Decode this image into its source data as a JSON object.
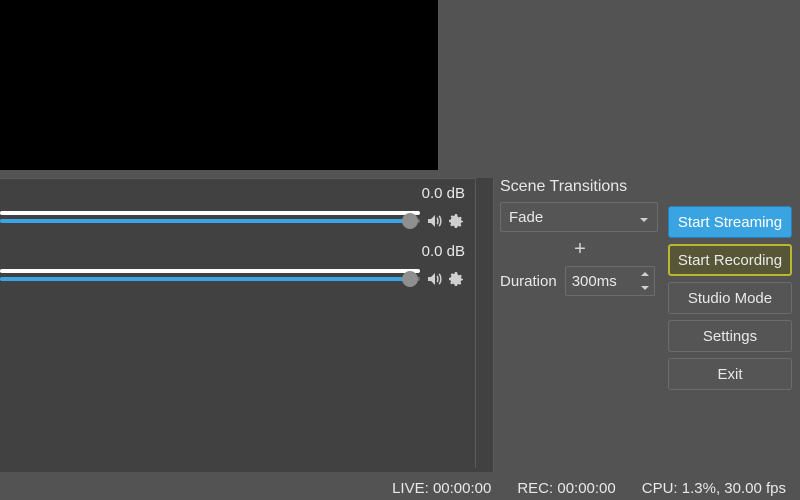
{
  "mixer": {
    "channels": [
      {
        "db": "0.0 dB"
      },
      {
        "db": "0.0 dB"
      }
    ]
  },
  "transitions": {
    "title": "Scene Transitions",
    "selected": "Fade",
    "duration_label": "Duration",
    "duration_value": "300ms"
  },
  "controls": {
    "start_streaming": "Start Streaming",
    "start_recording": "Start Recording",
    "studio_mode": "Studio Mode",
    "settings": "Settings",
    "exit": "Exit"
  },
  "status": {
    "live": "LIVE: 00:00:00",
    "rec": "REC: 00:00:00",
    "cpu": "CPU: 1.3%, 30.00 fps"
  }
}
